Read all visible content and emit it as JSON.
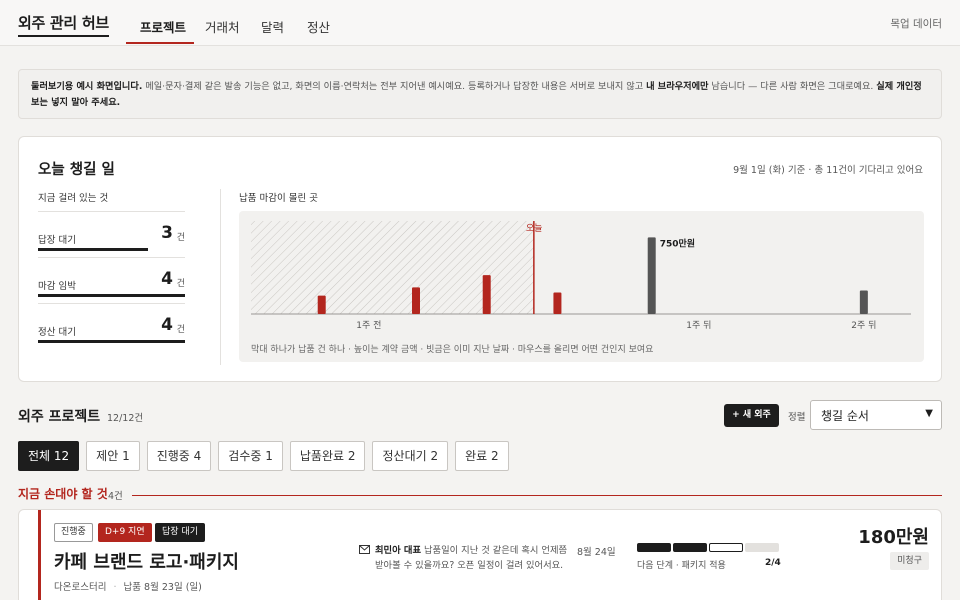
{
  "nav": {
    "brand": "외주 관리 허브",
    "tabs": [
      {
        "label": "프로젝트",
        "active": true
      },
      {
        "label": "거래처",
        "active": false
      },
      {
        "label": "달력",
        "active": false
      },
      {
        "label": "정산",
        "active": false
      }
    ],
    "mock_label": "목업 데이터"
  },
  "notice": {
    "bold1": "둘러보기용 예시 화면입니다.",
    "text1": " 메일·문자·결제 같은 발송 기능은 없고, 화면의 이름·연락처는 전부 지어낸 예시예요. 등록하거나 답장한 내용은 서버로 보내지 않고 ",
    "bold2": "내 브라우저에만",
    "text2": " 남습니다 — 다른 사람 화면은 그대로예요. ",
    "bold3": "실제 개인정보는 넣지 말아 주세요."
  },
  "today": {
    "title": "오늘 챙길 일",
    "meta": "9월 1일 (화) 기준 · 총 11건이 기다리고 있어요",
    "hang_title": "지금 걸려 있는 것",
    "stats": [
      {
        "label": "답장 대기",
        "value": "3",
        "unit": "건",
        "fill": 0.75
      },
      {
        "label": "마감 임박",
        "value": "4",
        "unit": "건",
        "fill": 1.0
      },
      {
        "label": "정산 대기",
        "value": "4",
        "unit": "건",
        "fill": 1.0
      }
    ],
    "chart_title": "납품 마감이 몰린 곳",
    "chart_note": "막대 하나가 납품 건 하나 · 높이는 계약 금액 · 빗금은 이미 지난 날짜 · 마우스를 올리면 어떤 건인지 보여요"
  },
  "chart_data": {
    "type": "bar",
    "title": "납품 마감이 몰린 곳",
    "x_unit": "days relative to today",
    "x_ticks": [
      {
        "value": -7,
        "label": "1주 전"
      },
      {
        "value": 7,
        "label": "1주 뒤"
      },
      {
        "value": 14,
        "label": "2주 뒤"
      }
    ],
    "today_value": 0,
    "today_label": "오늘",
    "past_hatched": true,
    "bars": [
      {
        "x": -9,
        "amount": 180,
        "status": "past",
        "color": "#b3261e"
      },
      {
        "x": -5,
        "amount": 260,
        "status": "past",
        "color": "#b3261e"
      },
      {
        "x": -2,
        "amount": 380,
        "status": "past",
        "color": "#b3261e"
      },
      {
        "x": 1,
        "amount": 210,
        "status": "urgent",
        "color": "#b3261e"
      },
      {
        "x": 5,
        "amount": 750,
        "status": "upcoming",
        "color": "#555555",
        "label": "750만원"
      },
      {
        "x": 14,
        "amount": 230,
        "status": "upcoming",
        "color": "#555555"
      }
    ],
    "ylim": [
      0,
      900
    ]
  },
  "projects": {
    "title": "외주 프로젝트",
    "count": "12/12건",
    "new_button": "+ 새 외주",
    "sort_label": "정렬",
    "sort_value": "챙길 순서",
    "filters": [
      {
        "label": "전체 12",
        "active": true
      },
      {
        "label": "제안 1",
        "active": false
      },
      {
        "label": "진행중 4",
        "active": false
      },
      {
        "label": "검수중 1",
        "active": false
      },
      {
        "label": "납품완료 2",
        "active": false
      },
      {
        "label": "정산대기 2",
        "active": false
      },
      {
        "label": "완료 2",
        "active": false
      }
    ],
    "urgent_title": "지금 손대야 할 것",
    "urgent_count": "4건"
  },
  "project_card": {
    "tags": [
      "진행중",
      "D+9 지연",
      "답장 대기"
    ],
    "title": "카페 브랜드 로고·패키지",
    "client": "다온로스터리",
    "due": "납품 8월 23일 (일)",
    "sender": "최민아 대표",
    "message": " 납품일이 지난 것 같은데 혹시 언제쯤 받아볼 수 있을까요? 오픈 일정이 걸려 있어서요.",
    "message_date": "8월 24일",
    "progress": {
      "done": 2,
      "current": 1,
      "total": 4
    },
    "next_step": "다음 단계 · 패키지 적용",
    "step_count": "2/4",
    "amount": "180만원",
    "billing": "미청구"
  }
}
